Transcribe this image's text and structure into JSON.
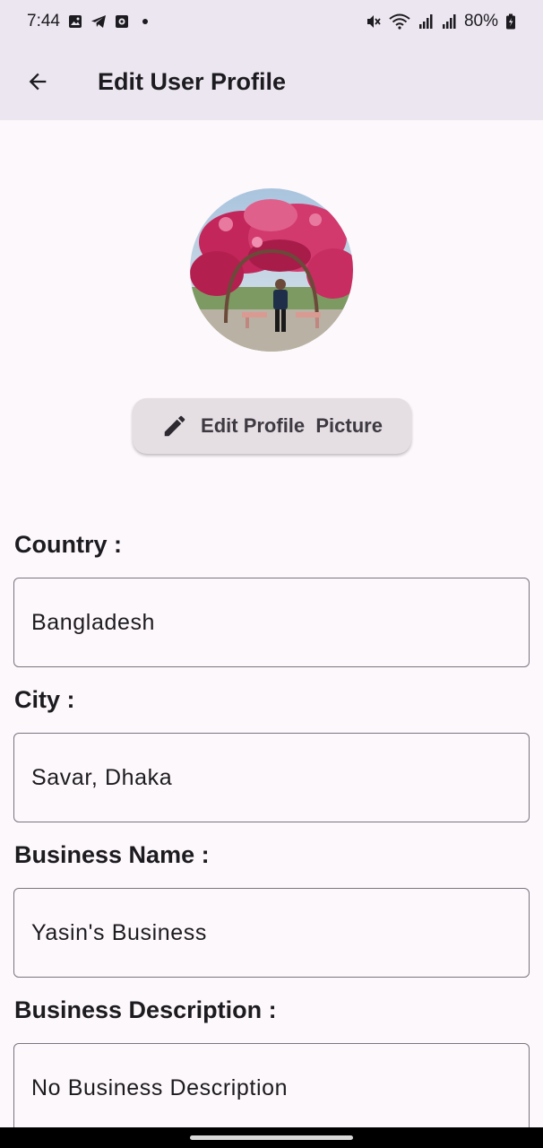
{
  "status_bar": {
    "time": "7:44",
    "battery": "80%",
    "icons": [
      "gallery-icon",
      "telegram-icon",
      "media-icon",
      "dot-icon",
      "mute-icon",
      "wifi-icon",
      "signal-icon",
      "signal-icon",
      "battery-icon"
    ]
  },
  "app_bar": {
    "title": "Edit User Profile",
    "back_icon": "arrow-back-icon"
  },
  "profile": {
    "edit_picture_label": "Edit Profile  Picture",
    "edit_icon": "pencil-icon"
  },
  "fields": [
    {
      "label": "Country :",
      "value": "Bangladesh"
    },
    {
      "label": "City :",
      "value": "Savar, Dhaka"
    },
    {
      "label": "Business Name :",
      "value": "Yasin's Business"
    },
    {
      "label": "Business Description :",
      "value": "No Business Description"
    }
  ],
  "colors": {
    "app_bar_bg": "#ece6f0",
    "page_bg": "#fdf8fc",
    "button_bg": "#e5dfe4",
    "field_border": "#7a757f"
  }
}
